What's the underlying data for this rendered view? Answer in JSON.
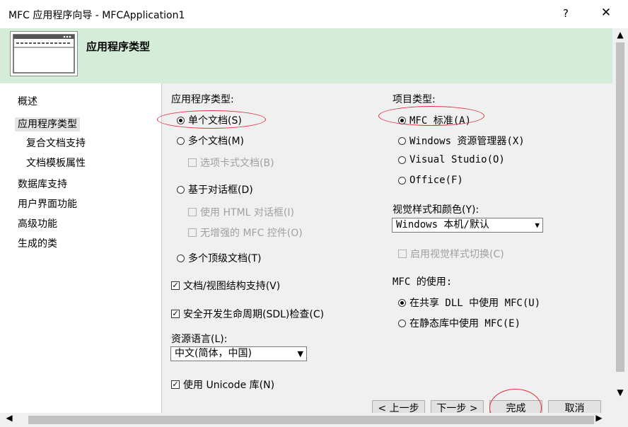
{
  "window": {
    "title": "MFC 应用程序向导 - MFCApplication1",
    "help": "?",
    "close": "✕"
  },
  "header": {
    "title": "应用程序类型"
  },
  "nav": {
    "items": [
      "概述",
      "应用程序类型",
      "复合文档支持",
      "文档模板属性",
      "数据库支持",
      "用户界面功能",
      "高级功能",
      "生成的类"
    ],
    "selected": "应用程序类型"
  },
  "app_type": {
    "label": "应用程序类型:",
    "single_doc": "单个文档(S)",
    "multi_doc": "多个文档(M)",
    "tabbed_doc": "选项卡式文档(B)",
    "dialog_based": "基于对话框(D)",
    "use_html_dialog": "使用 HTML 对话框(I)",
    "no_enhanced_mfc": "无增强的 MFC 控件(O)",
    "multi_toplevel": "多个顶级文档(T)",
    "selected": "单个文档(S)"
  },
  "doc_view": "文档/视图结构支持(V)",
  "sdl_check": "安全开发生命周期(SDL)检查(C)",
  "resource_language": {
    "label": "资源语言(L):",
    "value": "中文(简体，中国)"
  },
  "unicode": "使用 Unicode 库(N)",
  "project_type": {
    "label": "项目类型:",
    "mfc_standard": "MFC 标准(A)",
    "windows_explorer": "Windows 资源管理器(X)",
    "visual_studio": "Visual Studio(O)",
    "office": "Office(F)",
    "selected": "MFC 标准(A)"
  },
  "visual_style": {
    "label": "视觉样式和颜色(Y):",
    "value": "Windows 本机/默认",
    "switch": "启用视觉样式切换(C)"
  },
  "mfc_usage": {
    "label": "MFC 的使用:",
    "shared_dll": "在共享 DLL 中使用 MFC(U)",
    "static_lib": "在静态库中使用 MFC(E)",
    "selected": "在共享 DLL 中使用 MFC(U)"
  },
  "buttons": {
    "prev": "< 上一步",
    "next": "下一步 >",
    "finish": "完成",
    "cancel": "取消"
  },
  "colors": {
    "header_bg": "#d4ecd8",
    "annotation": "#e0323e"
  }
}
